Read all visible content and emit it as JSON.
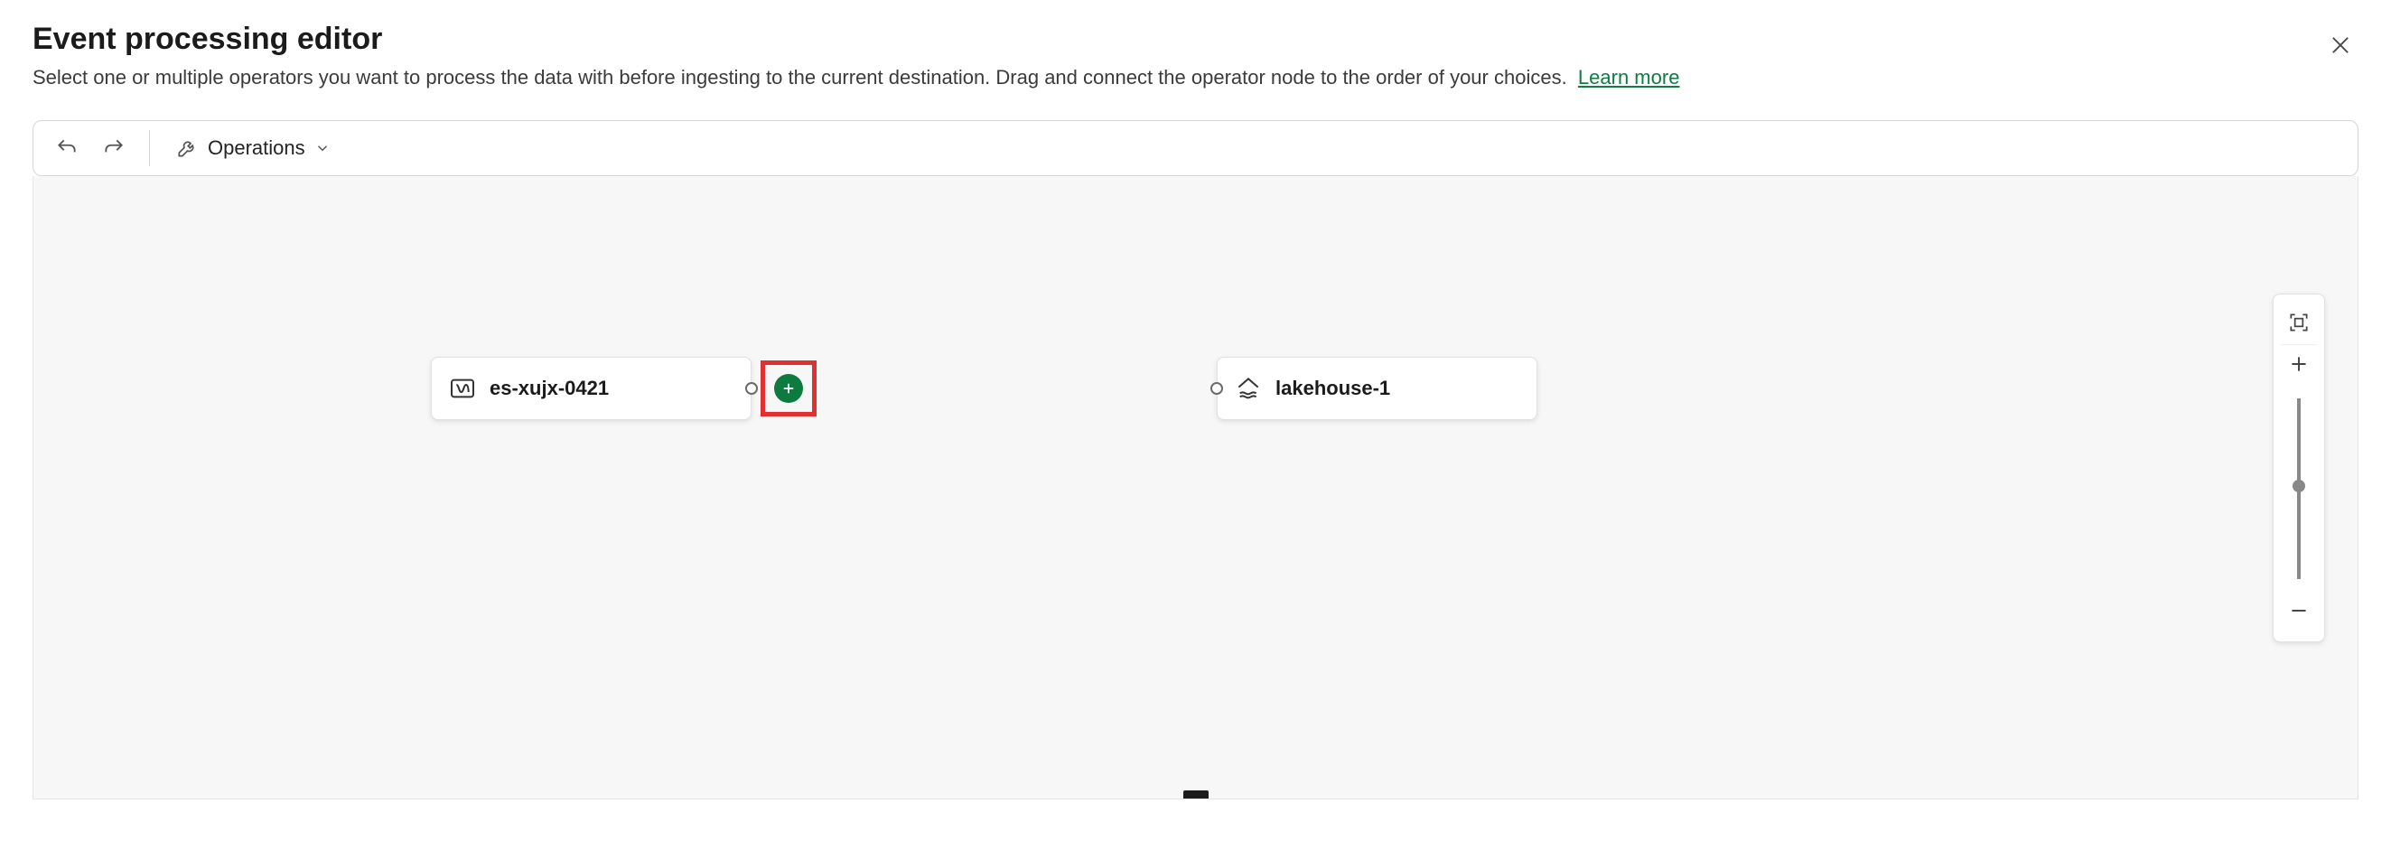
{
  "header": {
    "title": "Event processing editor",
    "subtitle": "Select one or multiple operators you want to process the data with before ingesting to the current destination. Drag and connect the operator node to the order of your choices.",
    "learn_more": "Learn more"
  },
  "toolbar": {
    "operations_label": "Operations"
  },
  "nodes": {
    "source": {
      "label": "es-xujx-0421"
    },
    "destination": {
      "label": "lakehouse-1"
    }
  },
  "colors": {
    "accent_green": "#0d7a3f",
    "highlight_red": "#e03030"
  }
}
